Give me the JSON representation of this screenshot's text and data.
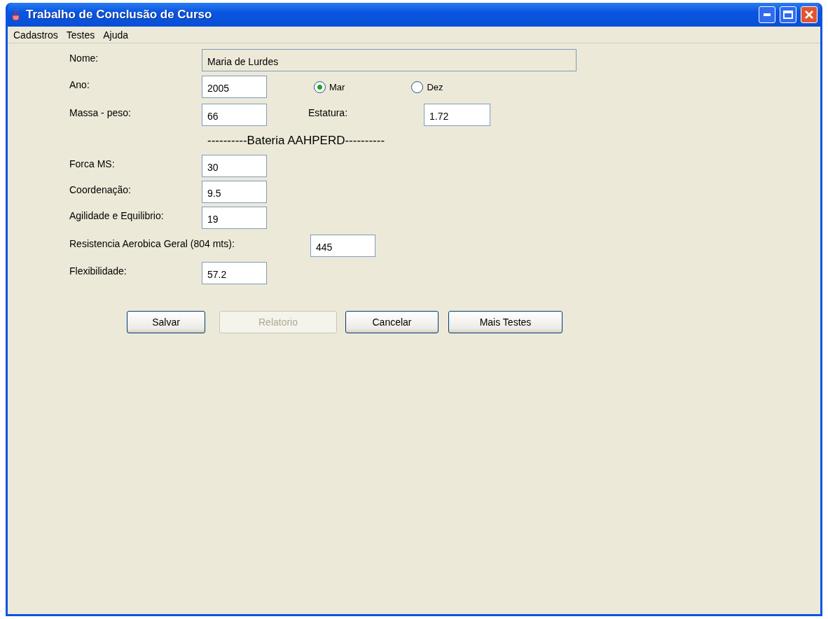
{
  "window": {
    "title": "Trabalho de Conclusão de Curso"
  },
  "menu": [
    "Cadastros",
    "Testes",
    "Ajuda"
  ],
  "nome": {
    "label": "Nome:",
    "value": "Maria de Lurdes"
  },
  "ano": {
    "label": "Ano:",
    "value": "2005"
  },
  "periods": [
    {
      "label": "Mar",
      "selected": true
    },
    {
      "label": "Dez",
      "selected": false
    }
  ],
  "massa": {
    "label": "Massa - peso:",
    "value": "66"
  },
  "estatura": {
    "label": "Estatura:",
    "value": "1.72"
  },
  "section_title": "----------Bateria AAHPERD----------",
  "tests": [
    {
      "label": "Forca MS:",
      "value": "30",
      "kind": "short"
    },
    {
      "label": "Coordenação:",
      "value": "9.5",
      "kind": "short"
    },
    {
      "label": "Agilidade e Equilibrio:",
      "value": "19",
      "kind": "short"
    },
    {
      "label": "Resistencia Aerobica Geral (804 mts):",
      "value": "445",
      "kind": "long"
    },
    {
      "label": "Flexibilidade:",
      "value": "57.2",
      "kind": "short"
    }
  ],
  "buttons": [
    {
      "label": "Salvar",
      "disabled": false
    },
    {
      "label": "Relatorio",
      "disabled": true
    },
    {
      "label": "Cancelar",
      "disabled": false
    },
    {
      "label": "Mais Testes",
      "disabled": false
    }
  ]
}
